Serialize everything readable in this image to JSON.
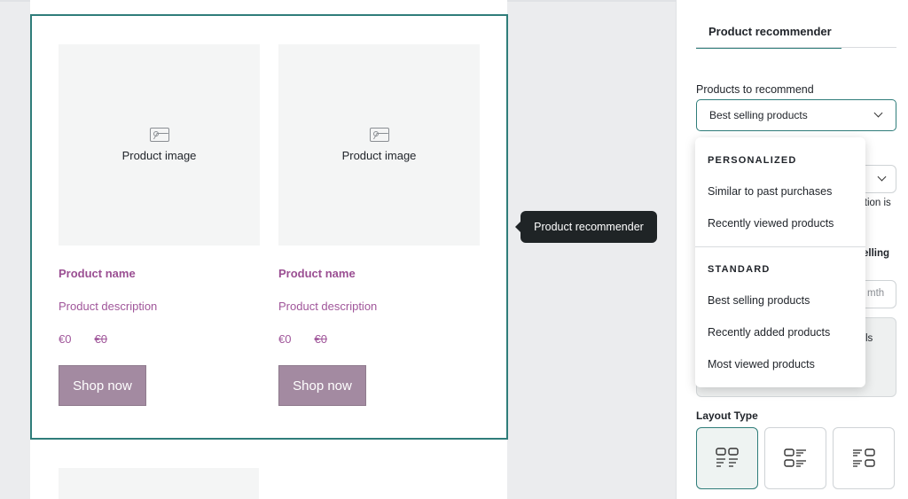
{
  "tooltip": "Product recommender",
  "products": [
    {
      "image_label": "Product image",
      "name": "Product name",
      "description": "Product description",
      "price": "€0",
      "old_price": "€0",
      "cta": "Shop now"
    },
    {
      "image_label": "Product image",
      "name": "Product name",
      "description": "Product description",
      "price": "€0",
      "old_price": "€0",
      "cta": "Shop now"
    }
  ],
  "panel": {
    "tab": "Product recommender",
    "products_to_recommend_label": "Products to recommend",
    "products_to_recommend_value": "Best selling products",
    "partial_texts": [
      "ction is",
      "elling",
      "mth",
      "ls"
    ],
    "layout_type_label": "Layout Type"
  },
  "dropdown": {
    "groups": [
      {
        "title": "PERSONALIZED",
        "items": [
          "Similar to past purchases",
          "Recently viewed products"
        ]
      },
      {
        "title": "STANDARD",
        "items": [
          "Best selling products",
          "Recently added products",
          "Most viewed products"
        ]
      }
    ]
  },
  "colors": {
    "accent": "#2f7d7a",
    "product_text": "#a0569a",
    "button": "#a38aa1"
  }
}
